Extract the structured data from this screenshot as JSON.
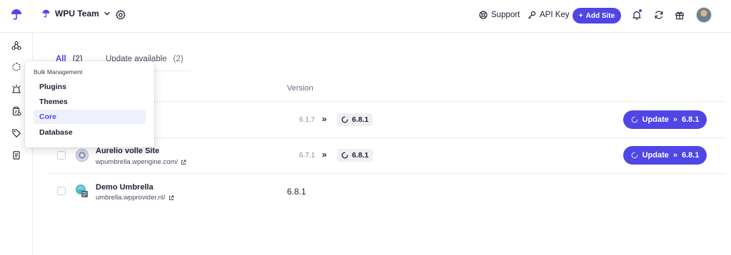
{
  "header": {
    "team_name": "WPU Team",
    "support_label": "Support",
    "api_key_label": "API Key",
    "add_site_label": "Add Site"
  },
  "tabs": [
    {
      "label": "All",
      "count": "(2)"
    },
    {
      "label": "Update available",
      "count": "(2)"
    }
  ],
  "table": {
    "version_header": "Version",
    "rows": [
      {
        "name": "",
        "url": "",
        "old_version": "6.1.7",
        "new_version": "6.8.1",
        "action_label": "Update",
        "action_version": "6.8.1"
      },
      {
        "name": "Aurelio volle Site",
        "url": "wpumbrella.wpengine.com/",
        "old_version": "6.7.1",
        "new_version": "6.8.1",
        "action_label": "Update",
        "action_version": "6.8.1"
      },
      {
        "name": "Demo Umbrella",
        "url": "umbrella.wpprovider.nl/",
        "current_version": "6.8.1"
      }
    ]
  },
  "dropdown": {
    "heading": "Bulk Management",
    "items": [
      "Plugins",
      "Themes",
      "Core",
      "Database"
    ],
    "active_index": 2
  },
  "colors": {
    "accent": "#4f46e5",
    "active_bg": "#eef0fb",
    "border": "#ececf1"
  },
  "icons": {
    "logo": "umbrella-icon",
    "sidebar": [
      "sites-icon",
      "bulk-management-icon",
      "alerts-icon",
      "reports-icon",
      "tags-icon",
      "logs-icon"
    ]
  }
}
